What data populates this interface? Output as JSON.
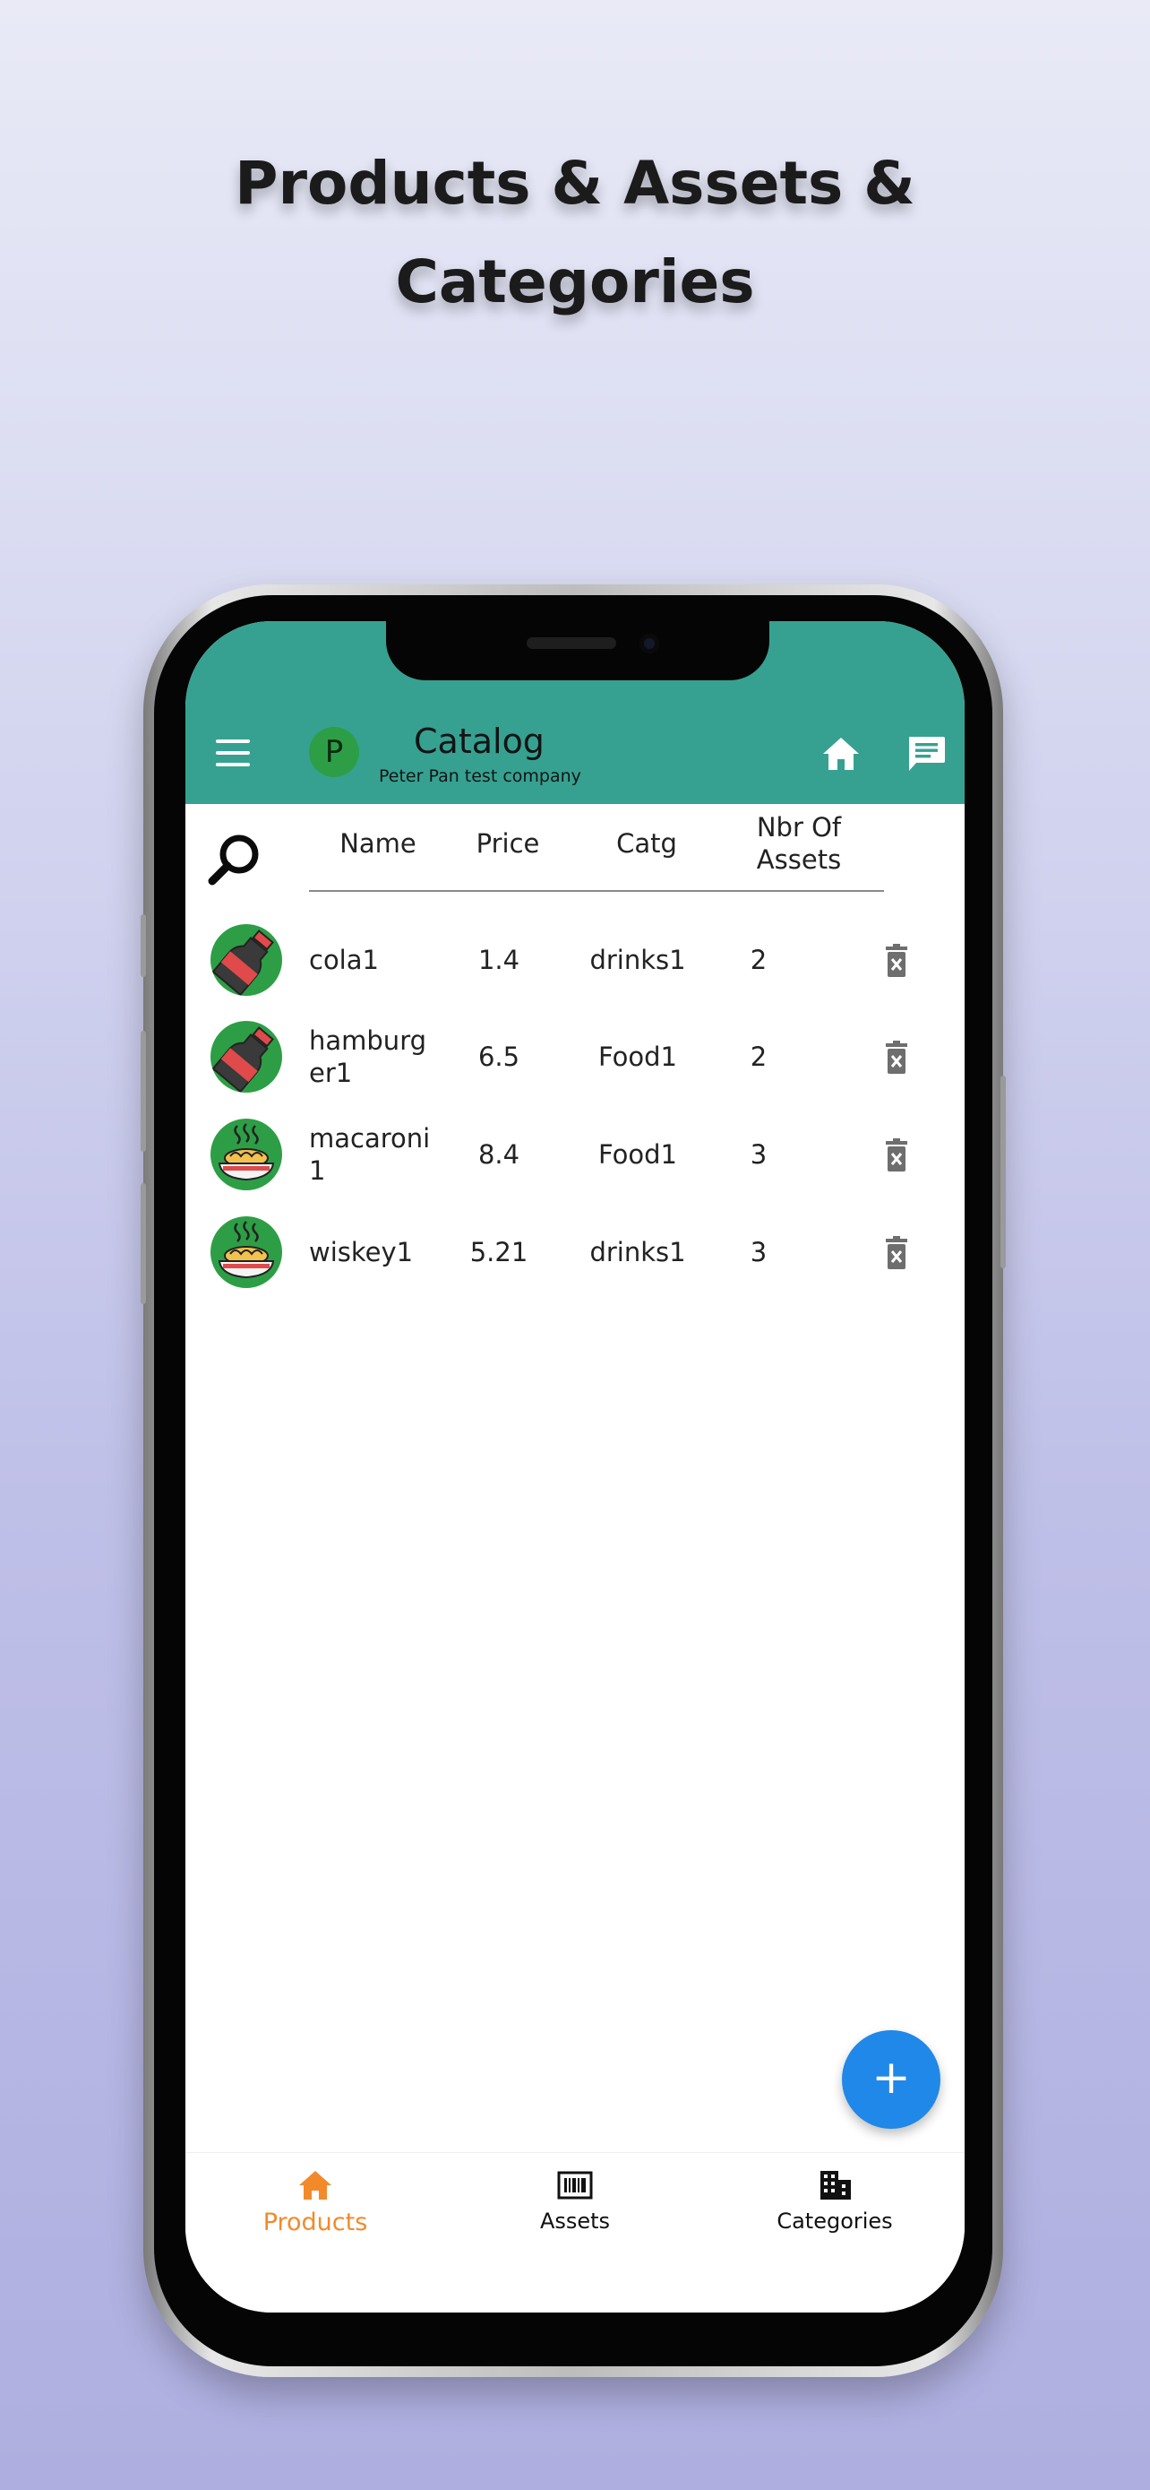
{
  "headline": {
    "line1": "Products & Assets &",
    "line2": "Categories"
  },
  "app_bar": {
    "avatar_letter": "P",
    "title": "Catalog",
    "subtitle": "Peter Pan test company",
    "color": "#36a191"
  },
  "table": {
    "headers": {
      "name": "Name",
      "price": "Price",
      "catg": "Catg",
      "nbr_line1": "Nbr Of",
      "nbr_line2": "Assets"
    },
    "rows": [
      {
        "name": "cola1",
        "name_line2": "",
        "price": "1.4",
        "catg": "drinks1",
        "nbr": "2",
        "icon": "bottle-icon"
      },
      {
        "name": "hamburg",
        "name_line2": "er1",
        "price": "6.5",
        "catg": "Food1",
        "nbr": "2",
        "icon": "bottle-icon"
      },
      {
        "name": "macaroni",
        "name_line2": "1",
        "price": "8.4",
        "catg": "Food1",
        "nbr": "3",
        "icon": "noodle-bowl-icon"
      },
      {
        "name": "wiskey1",
        "name_line2": "",
        "price": "5.21",
        "catg": "drinks1",
        "nbr": "3",
        "icon": "noodle-bowl-icon"
      }
    ]
  },
  "fab": {
    "label": "+",
    "color": "#2088e8"
  },
  "bottom_nav": {
    "items": [
      {
        "label": "Products",
        "icon": "home-icon",
        "active": true
      },
      {
        "label": "Assets",
        "icon": "barcode-icon",
        "active": false
      },
      {
        "label": "Categories",
        "icon": "building-icon",
        "active": false
      }
    ],
    "active_color": "#f28a2a"
  }
}
